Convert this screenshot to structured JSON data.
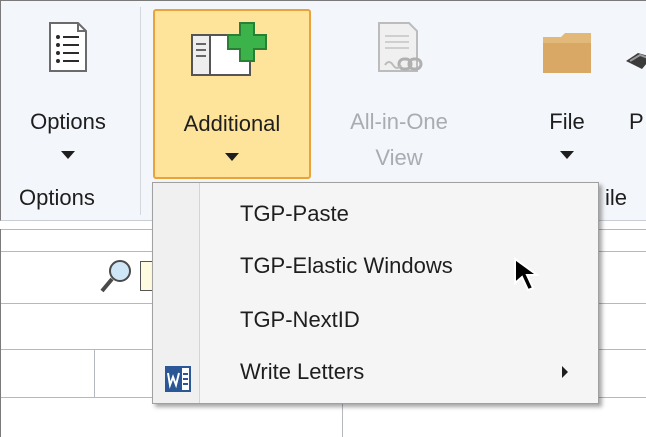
{
  "ribbon": {
    "buttons": {
      "options": {
        "label": "Options",
        "icon": "list-icon"
      },
      "additional": {
        "label": "Additional",
        "icon": "window-add-icon"
      },
      "all_in_one": {
        "label": "All-in-One View",
        "label_line1": "All-in-One",
        "label_line2": "View",
        "icon": "document-link-icon"
      },
      "file": {
        "label": "File",
        "icon": "folder-icon"
      },
      "partial": {
        "label": "P"
      }
    },
    "groups": {
      "options": "Options",
      "file_partial": "ile"
    }
  },
  "menu": {
    "items": [
      {
        "label": "TGP-Paste"
      },
      {
        "label": "TGP-Elastic Windows"
      },
      {
        "label": "TGP-NextID"
      },
      {
        "label": "Write Letters",
        "icon": "word-icon",
        "has_submenu": true
      }
    ]
  },
  "colors": {
    "active_bg": "#fde49a",
    "active_border": "#e8a33a",
    "ribbon_bg": "#f3f6fa",
    "plus_green": "#3bb34a"
  }
}
